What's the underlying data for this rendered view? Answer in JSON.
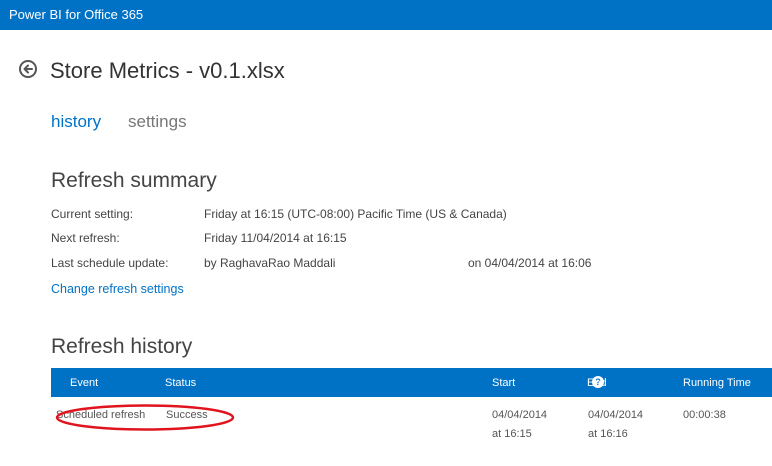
{
  "app": {
    "title": "Power BI for Office 365"
  },
  "page": {
    "title": "Store Metrics - v0.1.xlsx"
  },
  "tabs": [
    {
      "label": "history",
      "active": true
    },
    {
      "label": "settings",
      "active": false
    }
  ],
  "summary": {
    "title": "Refresh summary",
    "rows": [
      {
        "label": "Current setting:",
        "value": "Friday at 16:15 (UTC-08:00) Pacific Time (US & Canada)"
      },
      {
        "label": "Next refresh:",
        "value": "Friday 11/04/2014 at 16:15"
      },
      {
        "label": "Last schedule update:",
        "value": "by RaghavaRao Maddali",
        "extra": "on 04/04/2014 at 16:06"
      }
    ],
    "change_link": "Change refresh settings"
  },
  "history": {
    "title": "Refresh history",
    "columns": [
      "Event",
      "Status",
      "Start",
      "End",
      "Running Time"
    ],
    "help_icon": "?",
    "rows": [
      {
        "event": "Scheduled refresh",
        "status": "Success",
        "start_date": "04/04/2014",
        "start_time": "at 16:15",
        "end_date": "04/04/2014",
        "end_time": "at 16:16",
        "running_time": "00:00:38"
      }
    ]
  },
  "colors": {
    "accent": "#0072c6",
    "highlight_oval": "#e0141e"
  }
}
